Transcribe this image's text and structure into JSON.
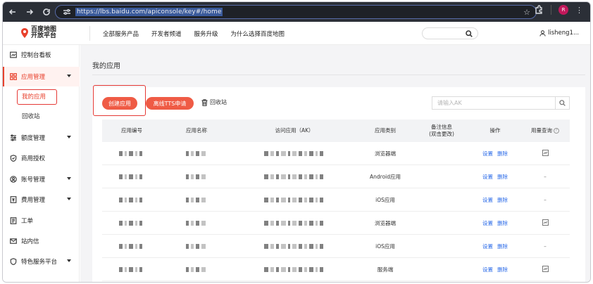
{
  "browser": {
    "url": "https://lbs.baidu.com/apiconsole/key#/home",
    "profile_initial": "R"
  },
  "header": {
    "logo_line1": "百度地图",
    "logo_line2": "开放平台",
    "nav": [
      "全部服务产品",
      "开发者频道",
      "服务升级",
      "为什么选择百度地图"
    ],
    "username": "lisheng1..."
  },
  "sidebar": {
    "items": [
      {
        "label": "控制台看板",
        "icon": "dashboard-icon"
      },
      {
        "label": "应用管理",
        "icon": "apps-icon",
        "expanded": true
      },
      {
        "label": "我的应用",
        "sub": true,
        "current": true
      },
      {
        "label": "回收站",
        "sub": true
      },
      {
        "label": "额度管理",
        "icon": "quota-icon",
        "caret": true
      },
      {
        "label": "商用授权",
        "icon": "shield-icon"
      },
      {
        "label": "账号管理",
        "icon": "account-icon",
        "caret": true
      },
      {
        "label": "费用管理",
        "icon": "billing-icon",
        "caret": true
      },
      {
        "label": "工单",
        "icon": "ticket-icon"
      },
      {
        "label": "站内信",
        "icon": "mail-icon"
      },
      {
        "label": "特色服务平台",
        "icon": "service-icon",
        "caret": true
      }
    ]
  },
  "main": {
    "page_title": "我的应用",
    "create_button": "创建应用",
    "tts_button": "离线TTS申请",
    "recycle_link": "回收站",
    "search_placeholder": "请输入AK",
    "columns": {
      "app_id": "应用编号",
      "app_name": "应用名称",
      "ak": "访问应用（AK）",
      "app_type": "应用类别",
      "remark_line1": "备注信息",
      "remark_line2": "(双击更改)",
      "ops": "操作",
      "usage": "用量查询"
    },
    "ops_labels": {
      "settings": "设置",
      "delete": "删除"
    },
    "usage_dash": "–",
    "rows": [
      {
        "app_type": "浏览器端",
        "usage_icon": true
      },
      {
        "app_type": "Android应用",
        "usage_icon": false
      },
      {
        "app_type": "iOS应用",
        "usage_icon": false
      },
      {
        "app_type": "浏览器端",
        "usage_icon": true
      },
      {
        "app_type": "iOS应用",
        "usage_icon": false
      },
      {
        "app_type": "服务端",
        "usage_icon": true
      }
    ]
  },
  "colors": {
    "accent": "#ef5b45",
    "link": "#2a6ae8",
    "highlight_box": "#e53935"
  }
}
